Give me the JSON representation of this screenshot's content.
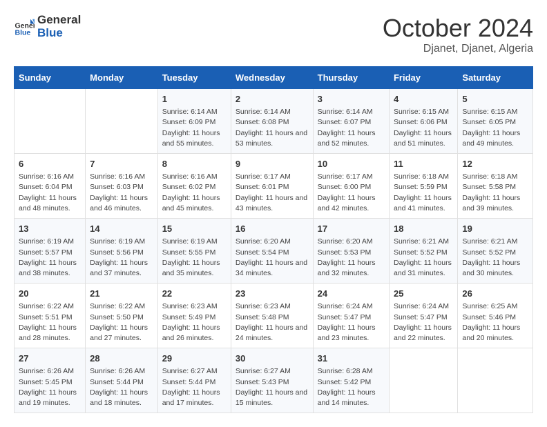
{
  "header": {
    "logo_general": "General",
    "logo_blue": "Blue",
    "month": "October 2024",
    "location": "Djanet, Djanet, Algeria"
  },
  "days_of_week": [
    "Sunday",
    "Monday",
    "Tuesday",
    "Wednesday",
    "Thursday",
    "Friday",
    "Saturday"
  ],
  "weeks": [
    [
      {
        "day": "",
        "info": ""
      },
      {
        "day": "",
        "info": ""
      },
      {
        "day": "1",
        "info": "Sunrise: 6:14 AM\nSunset: 6:09 PM\nDaylight: 11 hours and 55 minutes."
      },
      {
        "day": "2",
        "info": "Sunrise: 6:14 AM\nSunset: 6:08 PM\nDaylight: 11 hours and 53 minutes."
      },
      {
        "day": "3",
        "info": "Sunrise: 6:14 AM\nSunset: 6:07 PM\nDaylight: 11 hours and 52 minutes."
      },
      {
        "day": "4",
        "info": "Sunrise: 6:15 AM\nSunset: 6:06 PM\nDaylight: 11 hours and 51 minutes."
      },
      {
        "day": "5",
        "info": "Sunrise: 6:15 AM\nSunset: 6:05 PM\nDaylight: 11 hours and 49 minutes."
      }
    ],
    [
      {
        "day": "6",
        "info": "Sunrise: 6:16 AM\nSunset: 6:04 PM\nDaylight: 11 hours and 48 minutes."
      },
      {
        "day": "7",
        "info": "Sunrise: 6:16 AM\nSunset: 6:03 PM\nDaylight: 11 hours and 46 minutes."
      },
      {
        "day": "8",
        "info": "Sunrise: 6:16 AM\nSunset: 6:02 PM\nDaylight: 11 hours and 45 minutes."
      },
      {
        "day": "9",
        "info": "Sunrise: 6:17 AM\nSunset: 6:01 PM\nDaylight: 11 hours and 43 minutes."
      },
      {
        "day": "10",
        "info": "Sunrise: 6:17 AM\nSunset: 6:00 PM\nDaylight: 11 hours and 42 minutes."
      },
      {
        "day": "11",
        "info": "Sunrise: 6:18 AM\nSunset: 5:59 PM\nDaylight: 11 hours and 41 minutes."
      },
      {
        "day": "12",
        "info": "Sunrise: 6:18 AM\nSunset: 5:58 PM\nDaylight: 11 hours and 39 minutes."
      }
    ],
    [
      {
        "day": "13",
        "info": "Sunrise: 6:19 AM\nSunset: 5:57 PM\nDaylight: 11 hours and 38 minutes."
      },
      {
        "day": "14",
        "info": "Sunrise: 6:19 AM\nSunset: 5:56 PM\nDaylight: 11 hours and 37 minutes."
      },
      {
        "day": "15",
        "info": "Sunrise: 6:19 AM\nSunset: 5:55 PM\nDaylight: 11 hours and 35 minutes."
      },
      {
        "day": "16",
        "info": "Sunrise: 6:20 AM\nSunset: 5:54 PM\nDaylight: 11 hours and 34 minutes."
      },
      {
        "day": "17",
        "info": "Sunrise: 6:20 AM\nSunset: 5:53 PM\nDaylight: 11 hours and 32 minutes."
      },
      {
        "day": "18",
        "info": "Sunrise: 6:21 AM\nSunset: 5:52 PM\nDaylight: 11 hours and 31 minutes."
      },
      {
        "day": "19",
        "info": "Sunrise: 6:21 AM\nSunset: 5:52 PM\nDaylight: 11 hours and 30 minutes."
      }
    ],
    [
      {
        "day": "20",
        "info": "Sunrise: 6:22 AM\nSunset: 5:51 PM\nDaylight: 11 hours and 28 minutes."
      },
      {
        "day": "21",
        "info": "Sunrise: 6:22 AM\nSunset: 5:50 PM\nDaylight: 11 hours and 27 minutes."
      },
      {
        "day": "22",
        "info": "Sunrise: 6:23 AM\nSunset: 5:49 PM\nDaylight: 11 hours and 26 minutes."
      },
      {
        "day": "23",
        "info": "Sunrise: 6:23 AM\nSunset: 5:48 PM\nDaylight: 11 hours and 24 minutes."
      },
      {
        "day": "24",
        "info": "Sunrise: 6:24 AM\nSunset: 5:47 PM\nDaylight: 11 hours and 23 minutes."
      },
      {
        "day": "25",
        "info": "Sunrise: 6:24 AM\nSunset: 5:47 PM\nDaylight: 11 hours and 22 minutes."
      },
      {
        "day": "26",
        "info": "Sunrise: 6:25 AM\nSunset: 5:46 PM\nDaylight: 11 hours and 20 minutes."
      }
    ],
    [
      {
        "day": "27",
        "info": "Sunrise: 6:26 AM\nSunset: 5:45 PM\nDaylight: 11 hours and 19 minutes."
      },
      {
        "day": "28",
        "info": "Sunrise: 6:26 AM\nSunset: 5:44 PM\nDaylight: 11 hours and 18 minutes."
      },
      {
        "day": "29",
        "info": "Sunrise: 6:27 AM\nSunset: 5:44 PM\nDaylight: 11 hours and 17 minutes."
      },
      {
        "day": "30",
        "info": "Sunrise: 6:27 AM\nSunset: 5:43 PM\nDaylight: 11 hours and 15 minutes."
      },
      {
        "day": "31",
        "info": "Sunrise: 6:28 AM\nSunset: 5:42 PM\nDaylight: 11 hours and 14 minutes."
      },
      {
        "day": "",
        "info": ""
      },
      {
        "day": "",
        "info": ""
      }
    ]
  ]
}
